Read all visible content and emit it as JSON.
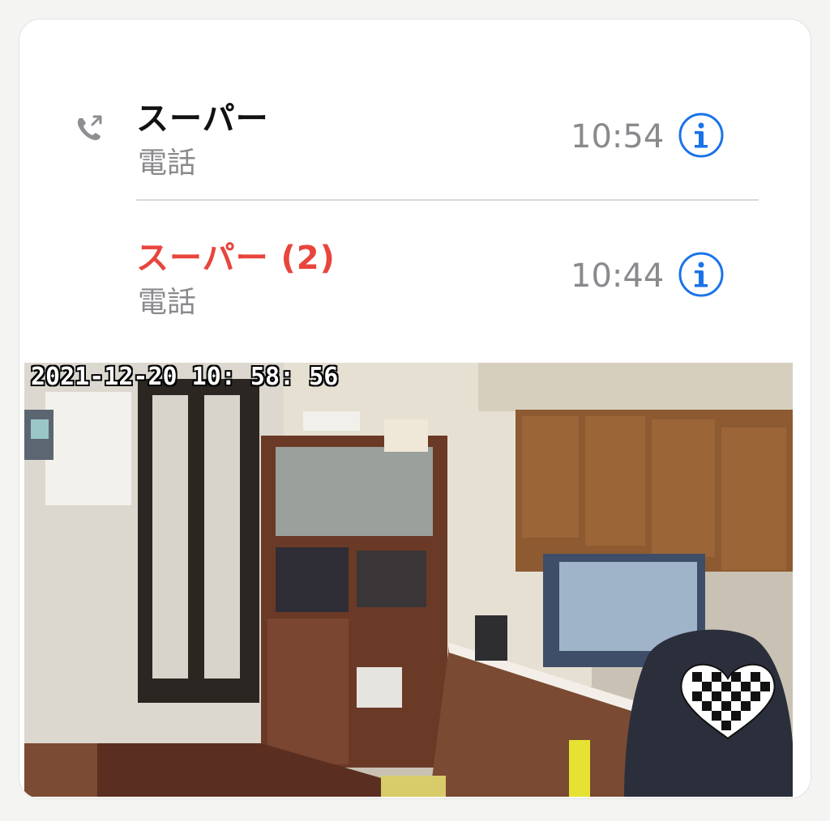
{
  "calls": [
    {
      "name": "スーパー",
      "type": "電話",
      "time": "10:54",
      "missed": false
    },
    {
      "name": "スーパー (2)",
      "type": "電話",
      "time": "10:44",
      "missed": true
    }
  ],
  "camera": {
    "timestamp": "2021-12-20  10: 58: 56"
  },
  "icons": {
    "outgoing": "phone-outgoing-icon",
    "info": "info-icon"
  },
  "colors": {
    "missed": "#e8453c",
    "accent": "#1a73e8",
    "secondary": "#8a8a8e"
  }
}
